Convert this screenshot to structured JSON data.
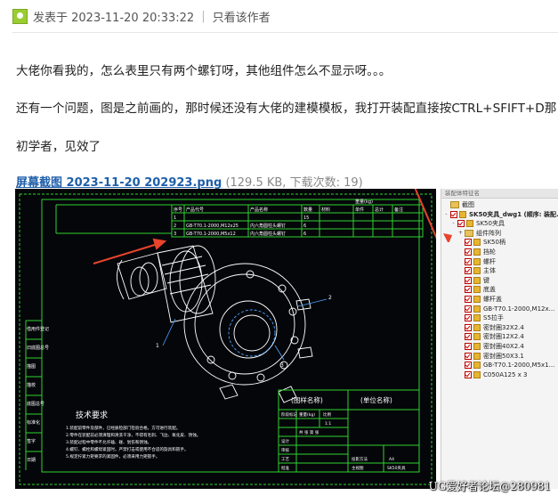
{
  "post_meta": {
    "posted_at": "发表于 2023-11-20 20:33:22",
    "separator": "|",
    "only_author": "只看该作者"
  },
  "paragraphs": [
    "大佬你看我的，怎么表里只有两个螺钉呀，其他组件怎么不显示呀。。。",
    "还有一个问题，图是之前画的，那时候还没有大佬的建模模板，我打开装配直接按CTRL+SFIFT+D那",
    "初学者，见效了"
  ],
  "attachment": {
    "name": "屏幕截图 2023-11-20 202923.png",
    "info": "(129.5 KB, 下载次数: 19)"
  },
  "drawing": {
    "bom_headers": [
      "序号",
      "产品代号",
      "产品名称",
      "数量",
      "材料",
      "单件",
      "总计",
      "备注"
    ],
    "bom_weight_header": "重量(kg)",
    "bom_rows": [
      [
        "1",
        "",
        "",
        "15",
        "",
        "",
        "",
        ""
      ],
      [
        "2",
        "GB-T70.1-2000,M12x25",
        "内六角圆柱头螺钉",
        "6",
        "",
        "",
        "",
        ""
      ],
      [
        "3",
        "GB-T70.1-2000,M5x12",
        "内六角圆柱头螺钉",
        "6",
        "",
        "",
        "",
        ""
      ]
    ],
    "balloons": [
      "1",
      "2",
      "3"
    ],
    "side_labels": [
      "借用件登记",
      "旧底图总号",
      "描图",
      "描校",
      "底图总号",
      "标准化",
      "签字",
      "日期"
    ],
    "tech_title": "技术要求",
    "tech_lines": [
      "1.装配前零件及部件，已经质检部门检验合格，方可进行装配。",
      "2.零件在装配前必须清理和清洗干净，不得有毛刺、飞边、氧化皮、锈蚀。",
      "3.装配过程中零件不允许磕、碰、划伤和锈蚀。",
      "4.螺钉、螺栓和螺母紧固时，严禁打击或使用不合适的旋具和扳手。",
      "5.规定拧紧力矩要求的紧固件，必须采用力矩扳手。"
    ],
    "title_block": {
      "name_placeholder": "(图样名称)",
      "unit_placeholder": "(单位名称)",
      "stage_mark": "阶段标记",
      "weight": "重量(kg)",
      "scale": "比例",
      "scale_value": "1:1",
      "sheet": "共 张 第 张",
      "design": "设计",
      "review": "审核",
      "craft": "工艺",
      "approve": "批准",
      "projection": "投影方法",
      "format": "A4",
      "doc_no": "SK50夹具",
      "assembly": "主视图"
    }
  },
  "tree": {
    "header": "装配体特征名",
    "items": [
      {
        "indent": 0,
        "type": "folder",
        "check": false,
        "toggle": "",
        "label": "截图"
      },
      {
        "indent": 0,
        "type": "asm",
        "check": true,
        "toggle": "-",
        "label": "SK50夹具_dwg1 (顺序: 装配...)"
      },
      {
        "indent": 1,
        "type": "asm",
        "check": true,
        "toggle": "-",
        "label": "SK50夹具"
      },
      {
        "indent": 2,
        "type": "folder",
        "check": false,
        "toggle": "+",
        "label": "组件阵列"
      },
      {
        "indent": 2,
        "type": "cube",
        "check": true,
        "toggle": "",
        "label": "SK50柄"
      },
      {
        "indent": 2,
        "type": "cube",
        "check": true,
        "toggle": "",
        "label": "挡轮"
      },
      {
        "indent": 2,
        "type": "cube",
        "check": true,
        "toggle": "",
        "label": "螺杆"
      },
      {
        "indent": 2,
        "type": "cube",
        "check": true,
        "toggle": "",
        "label": "主体"
      },
      {
        "indent": 2,
        "type": "cube",
        "check": true,
        "toggle": "",
        "label": "键"
      },
      {
        "indent": 2,
        "type": "cube",
        "check": true,
        "toggle": "",
        "label": "底盖"
      },
      {
        "indent": 2,
        "type": "cube",
        "check": true,
        "toggle": "",
        "label": "螺杆盖"
      },
      {
        "indent": 2,
        "type": "cube",
        "check": true,
        "toggle": "",
        "label": "GB-T70.1-2000,M12x..."
      },
      {
        "indent": 2,
        "type": "cube",
        "check": true,
        "toggle": "",
        "label": "S5拉手"
      },
      {
        "indent": 2,
        "type": "cube",
        "check": true,
        "toggle": "",
        "label": "密封圈32X2.4"
      },
      {
        "indent": 2,
        "type": "cube",
        "check": true,
        "toggle": "",
        "label": "密封圈12X2.4"
      },
      {
        "indent": 2,
        "type": "cube",
        "check": true,
        "toggle": "",
        "label": "密封圈40X2.4"
      },
      {
        "indent": 2,
        "type": "cube",
        "check": true,
        "toggle": "",
        "label": "密封圈50X3.1"
      },
      {
        "indent": 2,
        "type": "cube",
        "check": true,
        "toggle": "",
        "label": "GB-T70.1-2000,M5x1..."
      },
      {
        "indent": 2,
        "type": "cube",
        "check": true,
        "toggle": "",
        "label": "C050A125 x 3"
      }
    ]
  },
  "watermark": "UG爱好者论坛@280981",
  "colors": {
    "link": "#1f5faa",
    "cad_bg": "#05060a",
    "cad_frame": "#2fd32f",
    "cad_line": "#ffffff",
    "arrow": "#e8442c"
  }
}
